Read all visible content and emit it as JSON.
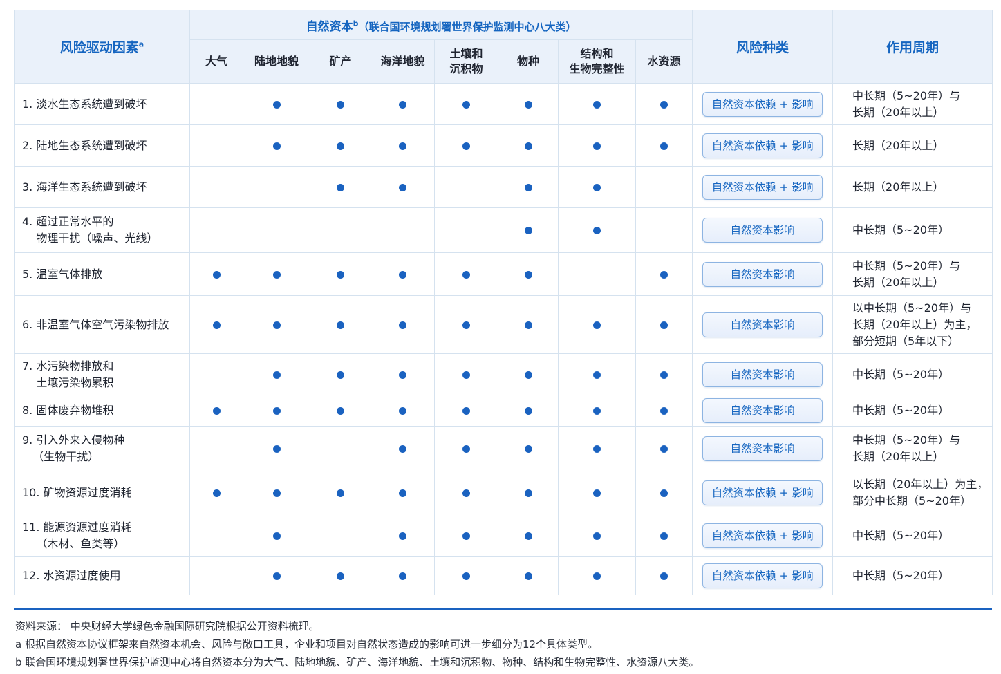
{
  "header": {
    "factor": "风险驱动因素",
    "factor_sup": "a",
    "capital": "自然资本",
    "capital_sup": "b",
    "capital_note": "（联合国环境规划署世界保护监测中心八大类）",
    "columns": [
      "大气",
      "陆地地貌",
      "矿产",
      "海洋地貌",
      "土壤和\n沉积物",
      "物种",
      "结构和\n生物完整性",
      "水资源"
    ],
    "risk_type": "风险种类",
    "period": "作用周期"
  },
  "rows": [
    {
      "factor": "1. 淡水生态系统遭到破坏",
      "dots": [
        0,
        1,
        1,
        1,
        1,
        1,
        1,
        1
      ],
      "type": "自然资本依赖 + 影响",
      "period": "中长期（5~20年）与\n长期（20年以上）"
    },
    {
      "factor": "2. 陆地生态系统遭到破坏",
      "dots": [
        0,
        1,
        1,
        1,
        1,
        1,
        1,
        1
      ],
      "type": "自然资本依赖 + 影响",
      "period": "长期（20年以上）"
    },
    {
      "factor": "3. 海洋生态系统遭到破坏",
      "dots": [
        0,
        0,
        1,
        1,
        0,
        1,
        1,
        0
      ],
      "type": "自然资本依赖 + 影响",
      "period": "长期（20年以上）"
    },
    {
      "factor": "4. 超过正常水平的\n    物理干扰（噪声、光线）",
      "dots": [
        0,
        0,
        0,
        0,
        0,
        1,
        1,
        0
      ],
      "type": "自然资本影响",
      "period": "中长期（5~20年）"
    },
    {
      "factor": "5. 温室气体排放",
      "dots": [
        1,
        1,
        1,
        1,
        1,
        1,
        0,
        1
      ],
      "type": "自然资本影响",
      "period": "中长期（5~20年）与\n长期（20年以上）"
    },
    {
      "factor": "6. 非温室气体空气污染物排放",
      "dots": [
        1,
        1,
        1,
        1,
        1,
        1,
        1,
        1
      ],
      "type": "自然资本影响",
      "period": "以中长期（5~20年）与\n长期（20年以上）为主，\n部分短期（5年以下）"
    },
    {
      "factor": "7. 水污染物排放和\n    土壤污染物累积",
      "dots": [
        0,
        1,
        1,
        1,
        1,
        1,
        1,
        1
      ],
      "type": "自然资本影响",
      "period": "中长期（5~20年）"
    },
    {
      "factor": "8. 固体废弃物堆积",
      "dots": [
        1,
        1,
        1,
        1,
        1,
        1,
        1,
        1
      ],
      "type": "自然资本影响",
      "period": "中长期（5~20年）"
    },
    {
      "factor": "9. 引入外来入侵物种\n   （生物干扰）",
      "dots": [
        0,
        1,
        0,
        1,
        1,
        1,
        1,
        1
      ],
      "type": "自然资本影响",
      "period": "中长期（5~20年）与\n长期（20年以上）"
    },
    {
      "factor": "10. 矿物资源过度消耗",
      "dots": [
        1,
        1,
        1,
        1,
        1,
        1,
        1,
        1
      ],
      "type": "自然资本依赖 + 影响",
      "period": "以长期（20年以上）为主，\n部分中长期（5~20年）"
    },
    {
      "factor": "11. 能源资源过度消耗\n    （木材、鱼类等）",
      "dots": [
        0,
        1,
        0,
        1,
        1,
        1,
        1,
        1
      ],
      "type": "自然资本依赖 + 影响",
      "period": "中长期（5~20年）"
    },
    {
      "factor": "12. 水资源过度使用",
      "dots": [
        0,
        1,
        1,
        1,
        1,
        1,
        1,
        1
      ],
      "type": "自然资本依赖 + 影响",
      "period": "中长期（5~20年）"
    }
  ],
  "notes": {
    "source": "资料来源：  中央财经大学绿色金融国际研究院根据公开资料梳理。",
    "a": "a 根据自然资本协议框架来自然资本机会、风险与敞口工具，企业和项目对自然状态造成的影响可进一步细分为12个具体类型。",
    "b": "b 联合国环境规划署世界保护监测中心将自然资本分为大气、陆地地貌、矿产、海洋地貌、土壤和沉积物、物种、结构和生物完整性、水资源八大类。"
  },
  "colors": {
    "accent": "#1565c0",
    "dot": "#1a62c0",
    "header_bg": "#eaf1fa",
    "border": "#d5e2ef"
  },
  "icons": {
    "dot": "filled-circle-icon"
  }
}
